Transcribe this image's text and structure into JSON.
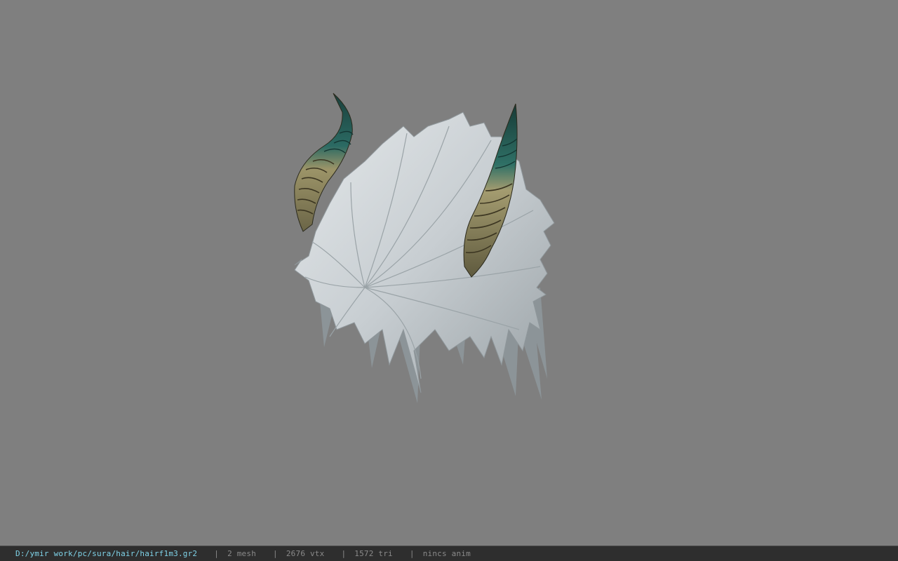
{
  "viewer": {
    "background_color": "#7f7f7f",
    "model_description_icon": "hair-with-horns-model"
  },
  "statusbar": {
    "file_path": "D:/ymir work/pc/sura/hair/hairf1m3.gr2",
    "separator": "|",
    "mesh_count": "2 mesh",
    "vertex_count": "2676 vtx",
    "triangle_count": "1572 tri",
    "animation_status": "nincs anim",
    "path_color": "#7fd3e8",
    "text_color": "#8a8a8a"
  }
}
